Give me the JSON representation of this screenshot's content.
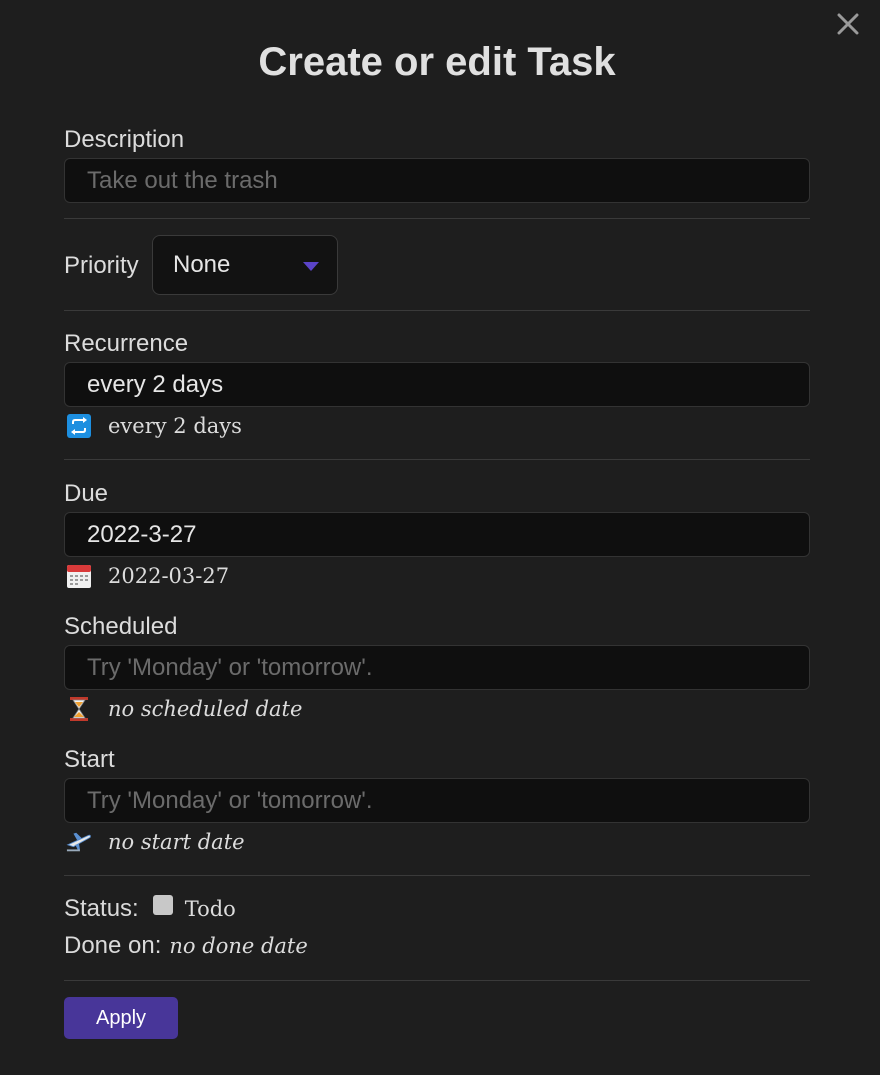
{
  "modal": {
    "title": "Create or edit Task"
  },
  "description": {
    "label": "Description",
    "placeholder": "Take out the trash",
    "value": ""
  },
  "priority": {
    "label": "Priority",
    "selected": "None"
  },
  "recurrence": {
    "label": "Recurrence",
    "value": "every 2 days",
    "preview_icon": "repeat-icon",
    "preview_text": "every 2 days"
  },
  "due": {
    "label": "Due",
    "value": "2022-3-27",
    "preview_icon": "calendar-icon",
    "preview_text": "2022-03-27"
  },
  "scheduled": {
    "label": "Scheduled",
    "placeholder": "Try 'Monday' or 'tomorrow'.",
    "value": "",
    "preview_icon": "hourglass-icon",
    "preview_text": "no scheduled date"
  },
  "start": {
    "label": "Start",
    "placeholder": "Try 'Monday' or 'tomorrow'.",
    "value": "",
    "preview_icon": "airplane-departure-icon",
    "preview_text": "no start date"
  },
  "status": {
    "label": "Status:",
    "value": "Todo",
    "checked": false
  },
  "done_on": {
    "label": "Done on:",
    "value": "no done date"
  },
  "apply_button": {
    "label": "Apply"
  },
  "colors": {
    "background": "#1e1e1e",
    "input_background": "#0f0f0f",
    "accent": "#483699",
    "caret": "#5b44c8"
  }
}
